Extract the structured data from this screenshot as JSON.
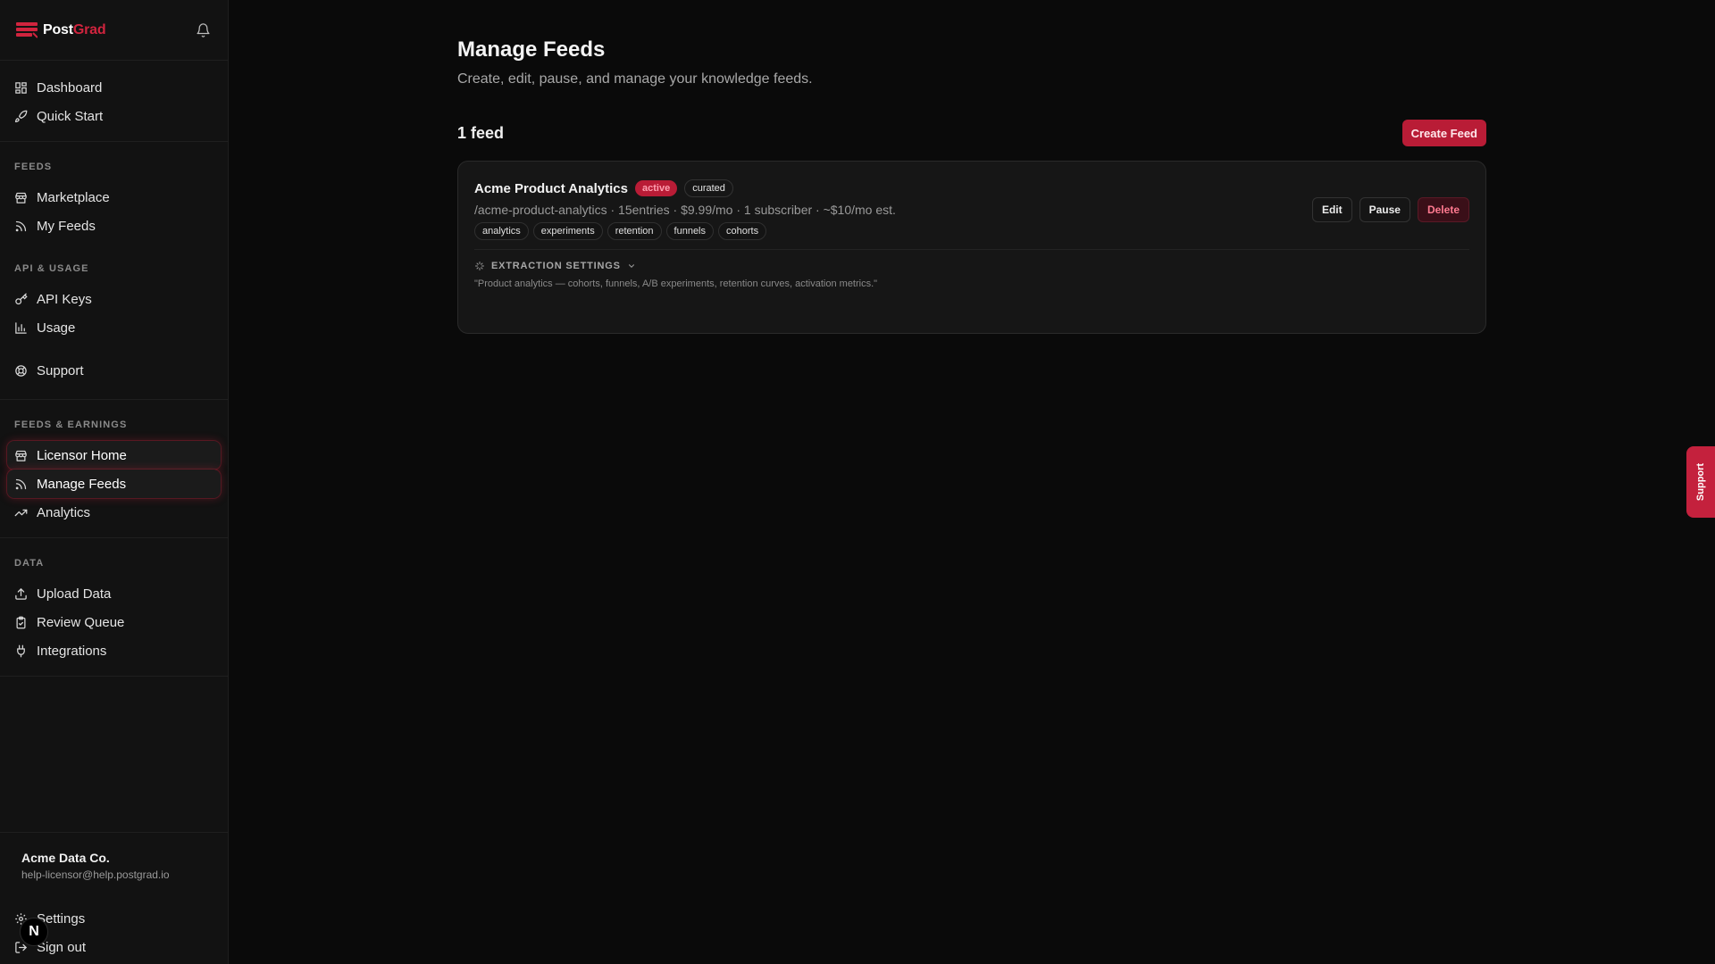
{
  "brand": {
    "name_part1": "Post",
    "name_part2": "Grad",
    "accent": "#d0243e"
  },
  "sidebar": {
    "primary": [
      {
        "label": "Dashboard",
        "icon": "dashboard-icon"
      },
      {
        "label": "Quick Start",
        "icon": "rocket-icon"
      }
    ],
    "feeds_label": "FEEDS",
    "feeds": [
      {
        "label": "Marketplace",
        "icon": "store-icon"
      },
      {
        "label": "My Feeds",
        "icon": "rss-icon"
      }
    ],
    "api_label": "API & USAGE",
    "api": [
      {
        "label": "API Keys",
        "icon": "key-icon"
      },
      {
        "label": "Usage",
        "icon": "bar-chart-icon"
      }
    ],
    "support": {
      "label": "Support",
      "icon": "lifebuoy-icon"
    },
    "earnings_label": "FEEDS & EARNINGS",
    "earnings": [
      {
        "label": "Licensor Home",
        "icon": "store-icon",
        "active": true
      },
      {
        "label": "Manage Feeds",
        "icon": "rss-icon",
        "active": true
      },
      {
        "label": "Analytics",
        "icon": "trending-up-icon",
        "active": false
      }
    ],
    "data_label": "DATA",
    "data": [
      {
        "label": "Upload Data",
        "icon": "upload-icon"
      },
      {
        "label": "Review Queue",
        "icon": "clipboard-check-icon"
      },
      {
        "label": "Integrations",
        "icon": "plug-icon"
      }
    ],
    "account": {
      "name": "Acme Data Co.",
      "email": "help-licensor@help.postgrad.io",
      "settings_label": "Settings",
      "signout_label": "Sign out",
      "badge": "N"
    }
  },
  "main": {
    "title": "Manage Feeds",
    "subtitle": "Create, edit, pause, and manage your knowledge feeds.",
    "feed_count": "1 feed",
    "create_button": "Create Feed",
    "feed": {
      "title": "Acme Product Analytics",
      "status": "active",
      "type": "curated",
      "meta": "/acme-product-analytics · 15entries · $9.99/mo · 1 subscriber · ~$10/mo est.",
      "tags": [
        "analytics",
        "experiments",
        "retention",
        "funnels",
        "cohorts"
      ],
      "edit": "Edit",
      "pause": "Pause",
      "delete": "Delete",
      "extraction_label": "EXTRACTION SETTINGS",
      "extraction_quote": "\"Product analytics — cohorts, funnels, A/B experiments, retention curves, activation metrics.\""
    }
  },
  "support_tab": "Support"
}
